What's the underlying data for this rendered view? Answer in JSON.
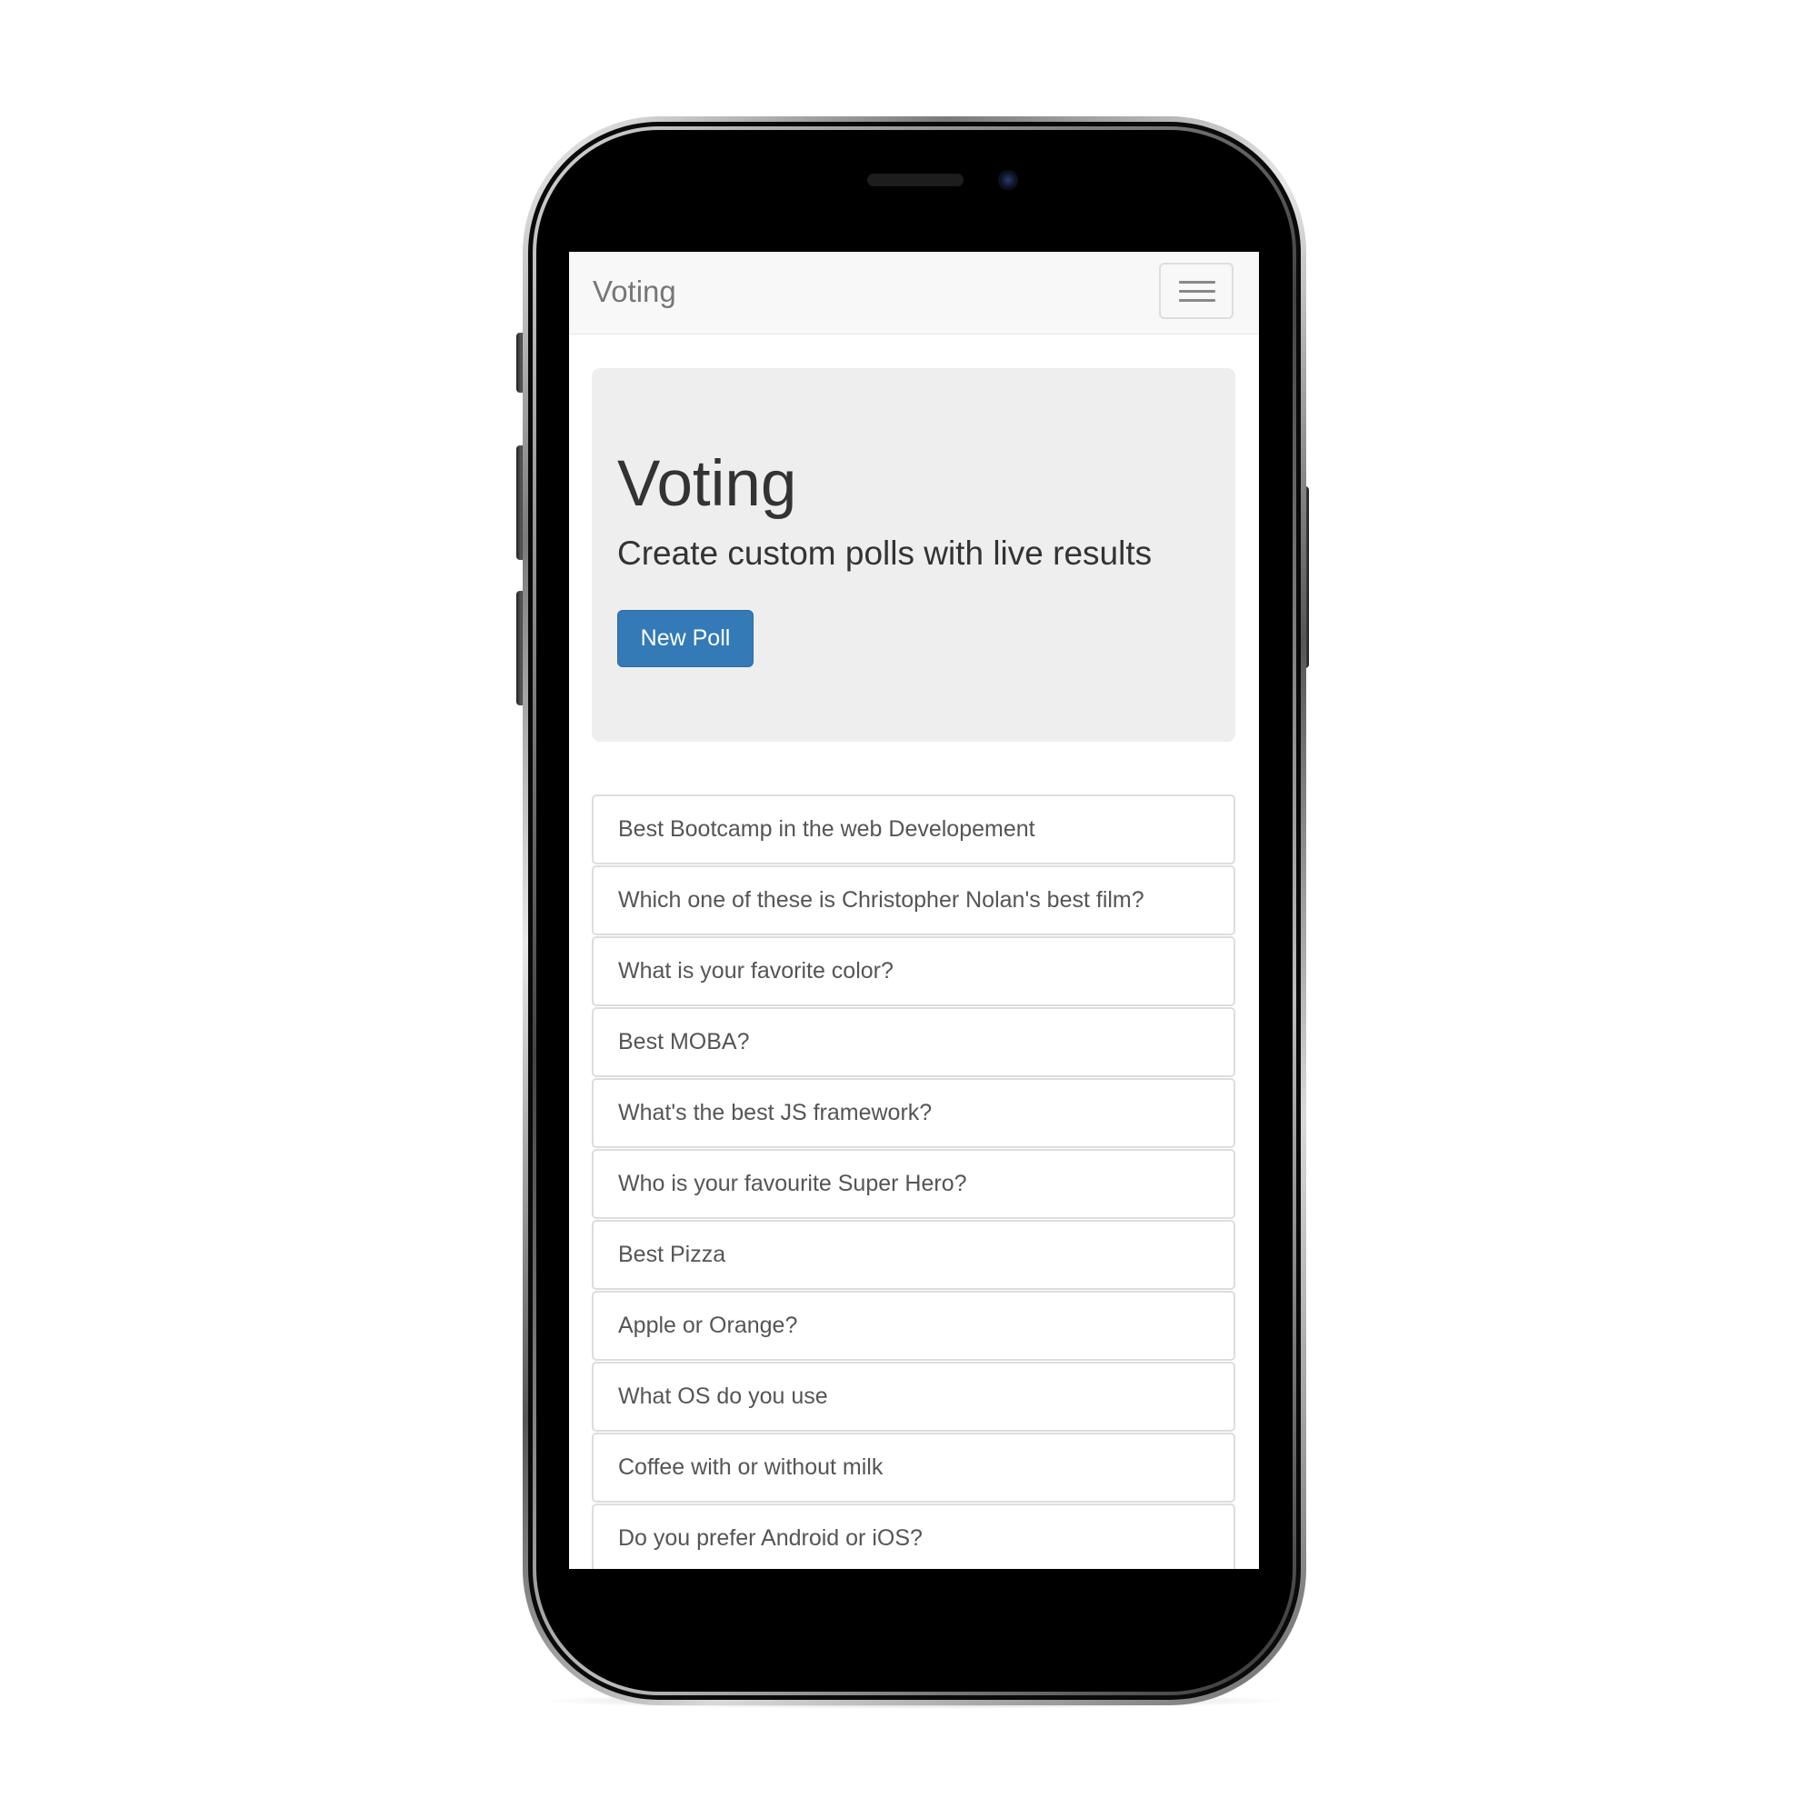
{
  "navbar": {
    "brand": "Voting",
    "toggle_icon": "hamburger-menu-icon"
  },
  "jumbotron": {
    "title": "Voting",
    "subtitle": "Create custom polls with live results",
    "button_label": "New Poll"
  },
  "polls": [
    "Best Bootcamp in the web Developement",
    "Which one of these is Christopher Nolan's best film?",
    "What is your favorite color?",
    "Best MOBA?",
    "What's the best JS framework?",
    "Who is your favourite Super Hero?",
    "Best Pizza",
    "Apple or Orange?",
    "What OS do you use",
    "Coffee with or without milk",
    "Do you prefer Android or iOS?"
  ],
  "colors": {
    "primary_button": "#337ab7",
    "jumbotron_bg": "#eeeeee",
    "navbar_bg": "#f8f8f8"
  }
}
